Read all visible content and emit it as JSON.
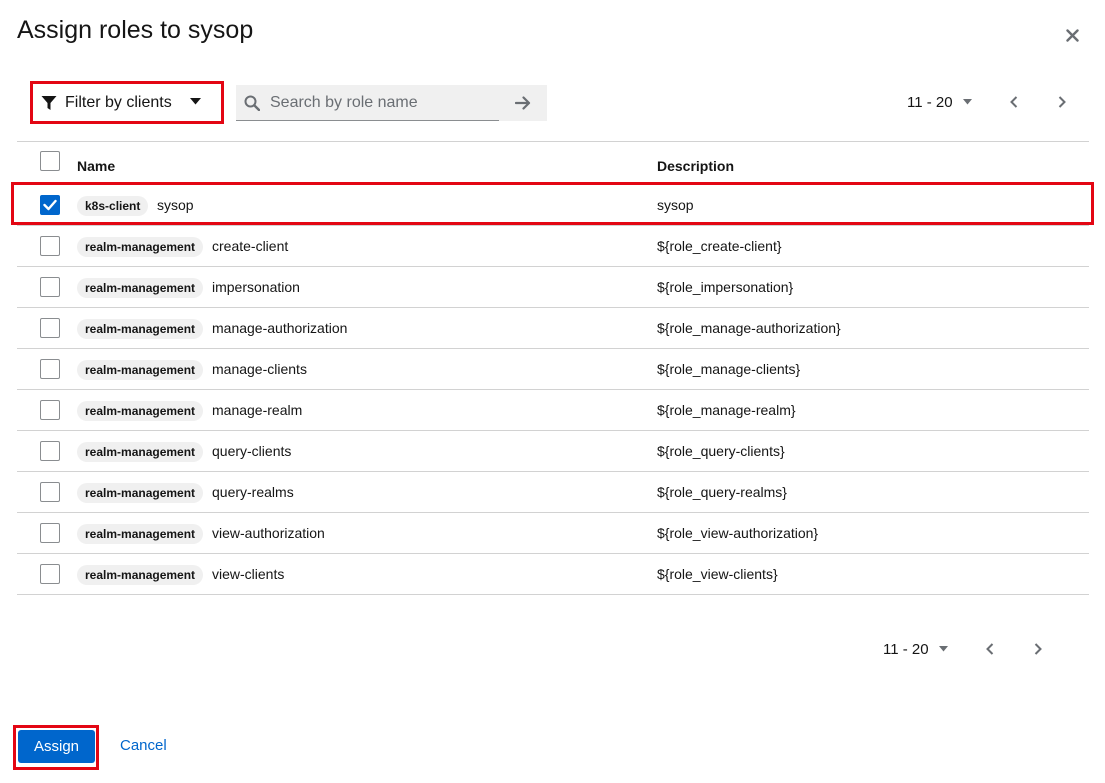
{
  "modal": {
    "title": "Assign roles to sysop"
  },
  "toolbar": {
    "filter_label": "Filter by clients",
    "search_placeholder": "Search by role name",
    "search_value": ""
  },
  "pagination": {
    "range": "11 - 20"
  },
  "table": {
    "columns": [
      "Name",
      "Description"
    ],
    "rows": [
      {
        "client": "k8s-client",
        "role": "sysop",
        "description": "sysop",
        "selected": true
      },
      {
        "client": "realm-management",
        "role": "create-client",
        "description": "${role_create-client}",
        "selected": false
      },
      {
        "client": "realm-management",
        "role": "impersonation",
        "description": "${role_impersonation}",
        "selected": false
      },
      {
        "client": "realm-management",
        "role": "manage-authorization",
        "description": "${role_manage-authorization}",
        "selected": false
      },
      {
        "client": "realm-management",
        "role": "manage-clients",
        "description": "${role_manage-clients}",
        "selected": false
      },
      {
        "client": "realm-management",
        "role": "manage-realm",
        "description": "${role_manage-realm}",
        "selected": false
      },
      {
        "client": "realm-management",
        "role": "query-clients",
        "description": "${role_query-clients}",
        "selected": false
      },
      {
        "client": "realm-management",
        "role": "query-realms",
        "description": "${role_query-realms}",
        "selected": false
      },
      {
        "client": "realm-management",
        "role": "view-authorization",
        "description": "${role_view-authorization}",
        "selected": false
      },
      {
        "client": "realm-management",
        "role": "view-clients",
        "description": "${role_view-clients}",
        "selected": false
      }
    ]
  },
  "footer": {
    "assign_label": "Assign",
    "cancel_label": "Cancel"
  },
  "colors": {
    "primary": "#0066cc",
    "highlight": "#e30613",
    "badge_bg": "#f0f0f0"
  }
}
